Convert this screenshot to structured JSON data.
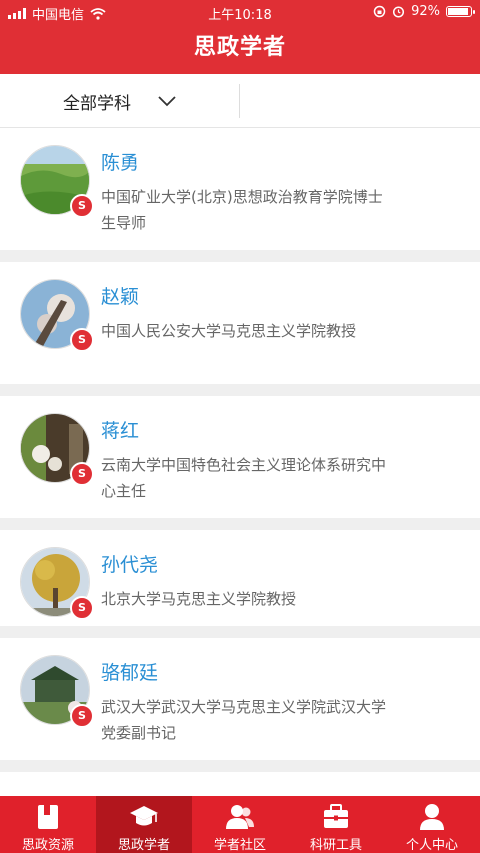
{
  "status_bar": {
    "carrier": "中国电信",
    "time": "上午10:18",
    "battery": "92%"
  },
  "header": {
    "title": "思政学者"
  },
  "filter": {
    "label": "全部学科"
  },
  "scholars": [
    {
      "name": "陈勇",
      "desc": "中国矿业大学(北京)思想政治教育学院博士生导师",
      "badge": "S"
    },
    {
      "name": "赵颖",
      "desc": "中国人民公安大学马克思主义学院教授",
      "badge": "S"
    },
    {
      "name": "蒋红",
      "desc": "云南大学中国特色社会主义理论体系研究中心主任",
      "badge": "S"
    },
    {
      "name": "孙代尧",
      "desc": "北京大学马克思主义学院教授",
      "badge": "S"
    },
    {
      "name": "骆郁廷",
      "desc": "武汉大学武汉大学马克思主义学院武汉大学党委副书记",
      "badge": "S"
    }
  ],
  "tabs": [
    {
      "label": "思政资源",
      "icon": "book-icon"
    },
    {
      "label": "思政学者",
      "icon": "graduation-cap-icon",
      "active": true
    },
    {
      "label": "学者社区",
      "icon": "people-icon"
    },
    {
      "label": "科研工具",
      "icon": "toolbox-icon"
    },
    {
      "label": "个人中心",
      "icon": "person-icon"
    }
  ]
}
